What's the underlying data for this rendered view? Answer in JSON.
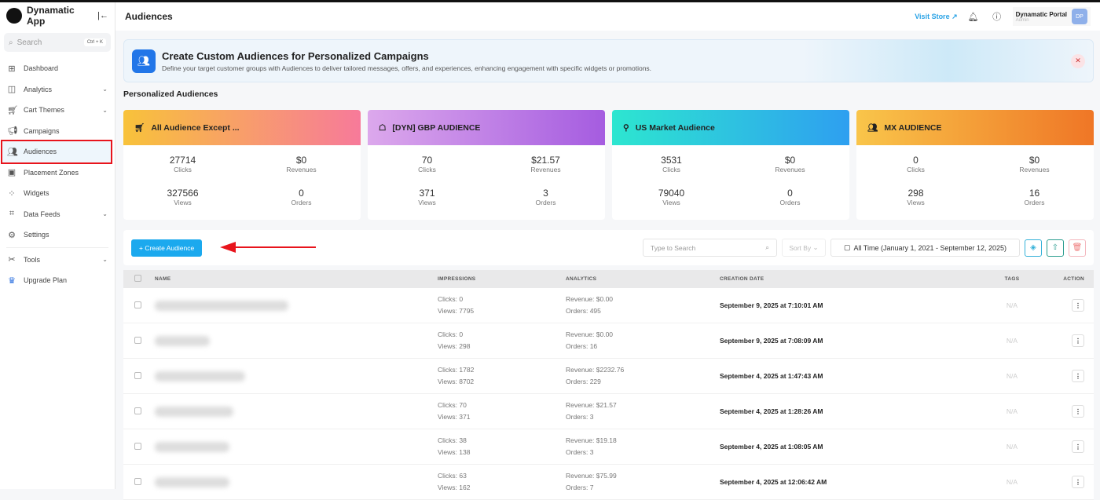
{
  "app": {
    "name": "Dynamatic App",
    "collapse_icon": "|←"
  },
  "search": {
    "placeholder": "Search",
    "shortcut": "Ctrl + K"
  },
  "nav": [
    {
      "label": "Dashboard",
      "icon": "grid-icon",
      "chev": false
    },
    {
      "label": "Analytics",
      "icon": "analytics-icon",
      "chev": true
    },
    {
      "label": "Cart Themes",
      "icon": "cart-icon",
      "chev": true
    },
    {
      "label": "Campaigns",
      "icon": "megaphone-icon",
      "chev": false
    },
    {
      "label": "Audiences",
      "icon": "users-icon",
      "chev": false,
      "active": true
    },
    {
      "label": "Placement Zones",
      "icon": "zone-icon",
      "chev": false
    },
    {
      "label": "Widgets",
      "icon": "widgets-icon",
      "chev": false
    },
    {
      "label": "Data Feeds",
      "icon": "feed-icon",
      "chev": true
    },
    {
      "label": "Settings",
      "icon": "gear-icon",
      "chev": false
    },
    {
      "label": "Tools",
      "icon": "tools-icon",
      "chev": true
    },
    {
      "label": "Upgrade Plan",
      "icon": "crown-icon",
      "chev": false
    }
  ],
  "header": {
    "title": "Audiences",
    "visit_store": "Visit Store",
    "user_name": "Dynamatic Portal",
    "user_role": "Admin",
    "avatar": "DP"
  },
  "banner": {
    "title": "Create Custom Audiences for Personalized Campaigns",
    "subtitle": "Define your target customer groups with Audiences to deliver tailored messages, offers, and experiences, enhancing engagement with specific widgets or promotions."
  },
  "section_title": "Personalized Audiences",
  "cards": [
    {
      "title": "All Audience Except ...",
      "clicks": "27714",
      "revenues": "$0",
      "views": "327566",
      "orders": "0",
      "gradient": [
        "#f8c23a",
        "#f77a9a"
      ]
    },
    {
      "title": "[DYN] GBP AUDIENCE",
      "clicks": "70",
      "revenues": "$21.57",
      "views": "371",
      "orders": "3",
      "gradient": [
        "#dca8ec",
        "#a55ce0"
      ]
    },
    {
      "title": "US Market Audience",
      "clicks": "3531",
      "revenues": "$0",
      "views": "79040",
      "orders": "0",
      "gradient": [
        "#2de6d0",
        "#2e9ff0"
      ]
    },
    {
      "title": "MX AUDIENCE",
      "clicks": "0",
      "revenues": "$0",
      "views": "298",
      "orders": "16",
      "gradient": [
        "#f9c54a",
        "#ef7626"
      ]
    }
  ],
  "labels": {
    "clicks": "Clicks",
    "revenues": "Revenues",
    "views": "Views",
    "orders": "Orders"
  },
  "toolbar": {
    "create": "+ Create Audience",
    "search_placeholder": "Type to Search",
    "sort": "Sort By",
    "date_range": "All Time (January 1, 2021 - September 12, 2025)"
  },
  "table": {
    "headers": [
      "NAME",
      "IMPRESSIONS",
      "ANALYTICS",
      "CREATION DATE",
      "TAGS",
      "ACTION"
    ],
    "rows": [
      {
        "clicks": "Clicks:  0",
        "views": "Views:  7795",
        "revenue": "Revenue:  $0.00",
        "orders": "Orders:  495",
        "date": "September 9, 2025 at 7:10:01 AM",
        "tags": "N/A"
      },
      {
        "clicks": "Clicks:  0",
        "views": "Views:  298",
        "revenue": "Revenue:  $0.00",
        "orders": "Orders:  16",
        "date": "September 9, 2025 at 7:08:09 AM",
        "tags": "N/A"
      },
      {
        "clicks": "Clicks:  1782",
        "views": "Views:  8702",
        "revenue": "Revenue:  $2232.76",
        "orders": "Orders:  229",
        "date": "September 4, 2025 at 1:47:43 AM",
        "tags": "N/A"
      },
      {
        "clicks": "Clicks:  70",
        "views": "Views:  371",
        "revenue": "Revenue:  $21.57",
        "orders": "Orders:  3",
        "date": "September 4, 2025 at 1:28:26 AM",
        "tags": "N/A"
      },
      {
        "clicks": "Clicks:  38",
        "views": "Views:  138",
        "revenue": "Revenue:  $19.18",
        "orders": "Orders:  3",
        "date": "September 4, 2025 at 1:08:05 AM",
        "tags": "N/A"
      },
      {
        "clicks": "Clicks:  63",
        "views": "Views:  162",
        "revenue": "Revenue:  $75.99",
        "orders": "Orders:  7",
        "date": "September 4, 2025 at 12:06:42 AM",
        "tags": "N/A"
      }
    ]
  }
}
